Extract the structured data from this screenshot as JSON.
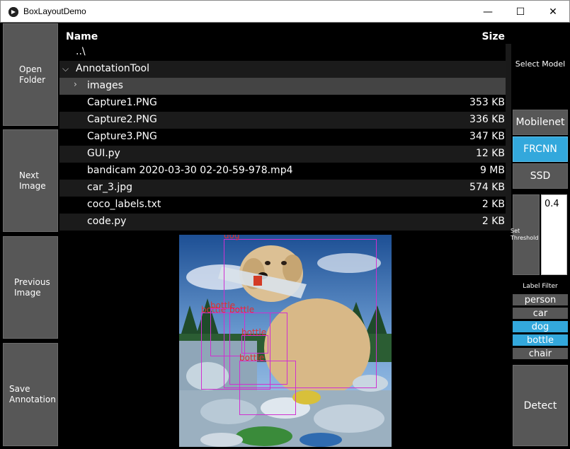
{
  "window": {
    "title": "BoxLayoutDemo",
    "minimize": "—",
    "maximize": "☐",
    "close": "✕"
  },
  "left_buttons": {
    "open_folder": "Open\nFolder",
    "next_image": "Next\nImage",
    "previous_image": "Previous\nImage",
    "save_annotation": "Save\nAnnotation"
  },
  "file_browser": {
    "header_name": "Name",
    "header_size": "Size",
    "rows": [
      {
        "name": "..\\",
        "size": ""
      },
      {
        "name": "AnnotationTool",
        "size": ""
      },
      {
        "name": "images",
        "size": ""
      },
      {
        "name": "Capture1.PNG",
        "size": "353 KB"
      },
      {
        "name": "Capture2.PNG",
        "size": "336 KB"
      },
      {
        "name": "Capture3.PNG",
        "size": "347 KB"
      },
      {
        "name": "GUI.py",
        "size": "12 KB"
      },
      {
        "name": "bandicam 2020-03-30 02-20-59-978.mp4",
        "size": "9 MB"
      },
      {
        "name": "car_3.jpg",
        "size": "574 KB"
      },
      {
        "name": "coco_labels.txt",
        "size": "2 KB"
      },
      {
        "name": "code.py",
        "size": "2 KB"
      }
    ]
  },
  "image": {
    "labels": [
      "dog",
      "bottle",
      "bottle",
      "bottle",
      "bottle",
      "bottle"
    ]
  },
  "right_panel": {
    "select_model": "Select Model",
    "models": [
      "Mobilenet",
      "FRCNN",
      "SSD"
    ],
    "selected_model": "FRCNN",
    "threshold_label": "Set\nThreshold",
    "threshold_value": "0.4",
    "label_filter_title": "Label Filter",
    "filters": [
      "person",
      "car",
      "dog",
      "bottle",
      "chair"
    ],
    "active_filters": [
      "dog",
      "bottle"
    ],
    "detect": "Detect"
  },
  "colors": {
    "button_gray": "#575757",
    "active_blue": "#33a8dc",
    "box_magenta": "#d030d0",
    "label_red": "#e03030"
  }
}
